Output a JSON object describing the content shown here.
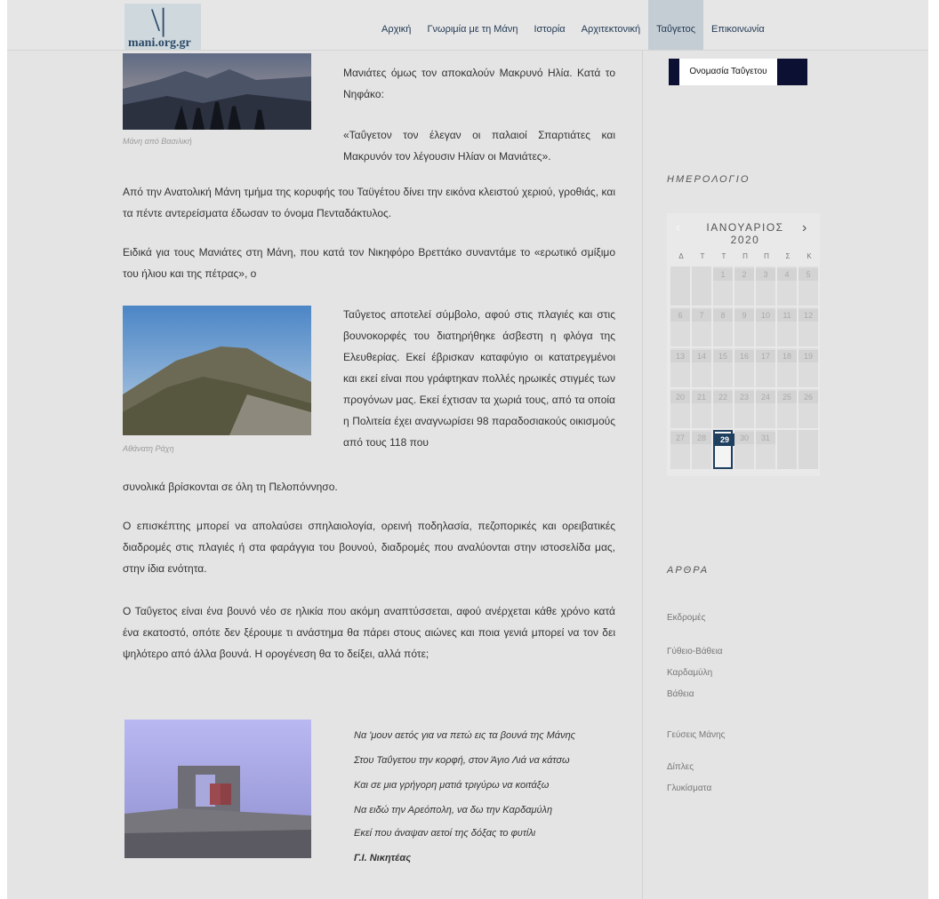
{
  "brand": {
    "logo_mark": "\\|",
    "logo_text": "mani.org.gr"
  },
  "nav": {
    "items": [
      {
        "label": "Αρχική"
      },
      {
        "label": "Γνωριμία με τη Μάνη"
      },
      {
        "label": "Ιστορία"
      },
      {
        "label": "Αρχιτεκτονική"
      },
      {
        "label": "Ταΰγετος"
      },
      {
        "label": "Επικοινωνία"
      }
    ],
    "active": "Ταΰγετος",
    "submenu_item": "Ονομασία Ταΰγετου"
  },
  "article": {
    "caption1": "Μάνη από Βασιλική",
    "caption2": "Αθάνατη Ράχη",
    "p_intro": "Μανιάτες όμως τον αποκαλούν Μακρυνό Ηλία. Κατά το Νηφάκο:",
    "p_quote": "«Ταΰγετον τον έλεγαν οι παλαιοί Σπαρτιάτες και Μακρυνόν τον λέγουσιν Ηλίαν οι Μανιάτες».",
    "p_east": "Από την Ανατολική Μάνη τμήμα της κορυφής του Ταϋγέτου δίνει την εικόνα κλειστού χεριού, γροθιάς, και τα πέντε αντερείσματα έδωσαν το όνομα Πενταδάκτυλος.",
    "p_maniates": "Ειδικά για τους Μανιάτες στη Μάνη, που κατά τον Νικηφόρο Βρεττάκο συναντάμε το «ερωτικό σμίξιμο του ήλιου και της πέτρας», ο",
    "p_symbol": "Ταΰγετος αποτελεί σύμβολο, αφού στις πλαγιές και στις βουνοκορφές του διατηρήθηκε άσβεστη η φλόγα της Ελευθερίας. Εκεί έβρισκαν καταφύγιο οι κατατρεγμένοι και εκεί είναι που γράφτηκαν πολλές ηρωικές στιγμές των προγόνων μας. Εκεί έχτισαν τα χωριά τους, από τα οποία η Πολιτεία έχει αναγνωρίσει 98 παραδοσιακούς οικισμούς από τους 118 που",
    "p_symbol_end": "συνολικά βρίσκονται σε όλη τη Πελοπόννησο.",
    "p_visitor": "Ο επισκέπτης μπορεί να απολαύσει σπηλαιολογία, ορεινή ποδηλασία, πεζοπορικές και ορειβατικές διαδρομές στις πλαγιές ή στα φαράγγια του βουνού, διαδρομές που αναλύονται στην ιστοσελίδα μας, στην ίδια ενότητα.",
    "p_young": "Ο Ταΰγετος είναι ένα βουνό νέο σε ηλικία που ακόμη αναπτύσσεται, αφού ανέρχεται κάθε χρόνο κατά ένα εκατοστό, οπότε δεν ξέρουμε τι ανάστημα θα πάρει στους αιώνες και ποια γενιά μπορεί να τον δει ψηλότερο από άλλα βουνά. Η ορογένεση θα το δείξει, αλλά πότε;",
    "poem": [
      "Να 'μουν αετός για να πετώ εις τα βουνά της Μάνης",
      "Στου Ταΰγετου την κορφή, στον Άγιο Λιά να κάτσω",
      "Και σε μια γρήγορη ματιά τριγύρω να κοιτάξω",
      "Να ειδώ την Αρεόπολη, να δω την Καρδαμύλη",
      "Εκεί που άναψαν αετοί της δόξας το φυτίλι"
    ],
    "poem_author": "Γ.Ι. Νικητέας"
  },
  "calendar": {
    "heading": "ΗΜΕΡΟΛΟΓΙΟ",
    "title": "ΙΑΝΟΥΑΡΙΟΣ 2020",
    "prev_icon": "chevron-left-icon",
    "next_icon": "chevron-right-icon",
    "weekdays": [
      "Δ",
      "Τ",
      "Τ",
      "Π",
      "Π",
      "Σ",
      "Κ"
    ],
    "leading_blanks": 2,
    "days": [
      "1",
      "2",
      "3",
      "4",
      "5",
      "6",
      "7",
      "8",
      "9",
      "10",
      "11",
      "12",
      "13",
      "14",
      "15",
      "16",
      "17",
      "18",
      "19",
      "20",
      "21",
      "22",
      "23",
      "24",
      "25",
      "26",
      "27",
      "28",
      "29",
      "30",
      "31"
    ],
    "today": "29"
  },
  "articles_sidebar": {
    "heading": "ΑΡΘΡΑ",
    "links": [
      "Εκδρομές",
      "Γύθειο-Βάθεια",
      "Καρδαμύλη",
      "Βάθεια",
      "Γεύσεις Μάνης",
      "Δίπλες",
      "Γλυκίσματα"
    ]
  },
  "colors": {
    "accent": "#1f3f5e",
    "submenu_bg": "#0c1033",
    "nav_text": "#223a55"
  }
}
